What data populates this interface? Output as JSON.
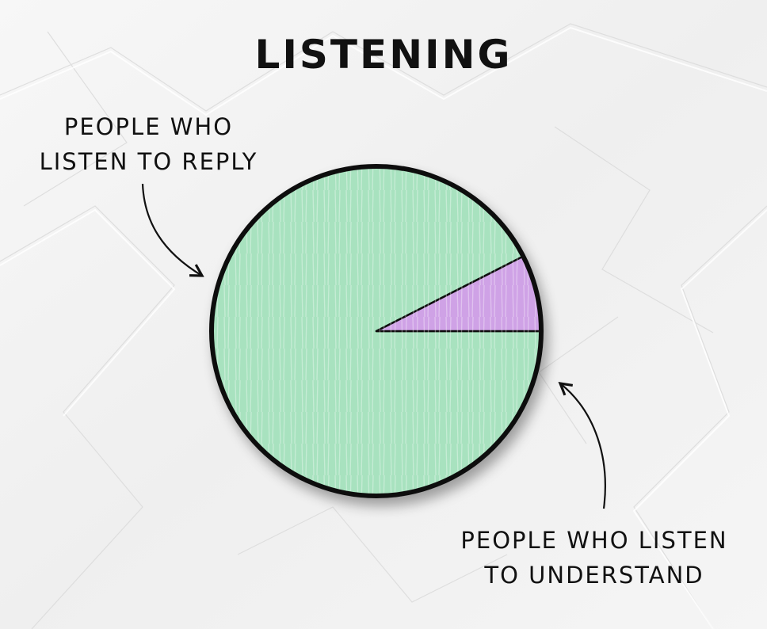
{
  "chart_data": {
    "type": "pie",
    "title": "LISTENING",
    "slices": [
      {
        "label": "PEOPLE WHO LISTEN TO REPLY",
        "label_lines": [
          "PEOPLE WHO",
          "LISTEN TO REPLY"
        ],
        "value": 92.5,
        "color": "#a8e2bf"
      },
      {
        "label": "PEOPLE WHO LISTEN TO UNDERSTAND",
        "label_lines": [
          "PEOPLE WHO LISTEN",
          "TO UNDERSTAND"
        ],
        "value": 7.5,
        "color": "#cfa2e6"
      }
    ],
    "start_angle_deg": 0,
    "legend": "callouts"
  },
  "colors": {
    "paper": "#f2f2f2",
    "ink": "#111111"
  }
}
